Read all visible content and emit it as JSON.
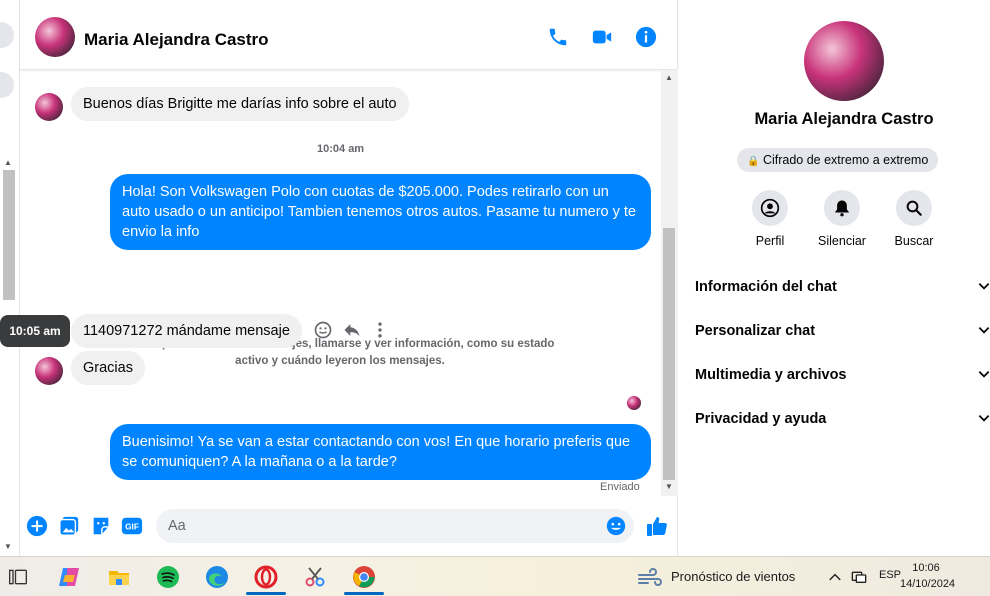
{
  "chat": {
    "contact_name": "Maria Alejandra Castro",
    "header_icons": [
      "phone-icon",
      "video-icon",
      "info-icon"
    ],
    "messages": [
      {
        "direction": "in",
        "text": "Buenos días Brigitte me darías info sobre el auto"
      },
      {
        "direction": "timestamp",
        "text": "10:04 am"
      },
      {
        "direction": "out",
        "text": "Hola! Son Volkswagen Polo con cuotas de $205.000. Podes retirarlo con un auto usado o un anticipo! Tambien tenemos otros autos. Pasame tu numero y te envio la info"
      },
      {
        "direction": "notice",
        "text": "Ahora pueden enviarse mensajes, llamarse y ver información, como su estado activo y cuándo leyeron los mensajes."
      },
      {
        "direction": "in",
        "text": "1140971272 mándame mensaje",
        "hover_time": "10:05 am"
      },
      {
        "direction": "in",
        "text": "Gracias"
      },
      {
        "direction": "out",
        "text": "Buenisimo! Ya se van a estar contactando con vos! En que horario preferis que se comuniquen? A la mañana o a la tarde?"
      }
    ],
    "sent_status": "Enviado",
    "composer": {
      "placeholder": "Aa"
    },
    "accent": "#0084ff"
  },
  "info_panel": {
    "name": "Maria Alejandra Castro",
    "encryption_badge": "Cifrado de extremo a extremo",
    "actions": [
      {
        "label": "Perfil",
        "icon": "profile-icon"
      },
      {
        "label": "Silenciar",
        "icon": "bell-icon"
      },
      {
        "label": "Buscar",
        "icon": "search-icon"
      }
    ],
    "sections": [
      "Información del chat",
      "Personalizar chat",
      "Multimedia y archivos",
      "Privacidad y ayuda"
    ]
  },
  "taskbar": {
    "weather": "Pronóstico de vientos",
    "language": "ESP",
    "time": "10:06",
    "date": "14/10/2024"
  }
}
